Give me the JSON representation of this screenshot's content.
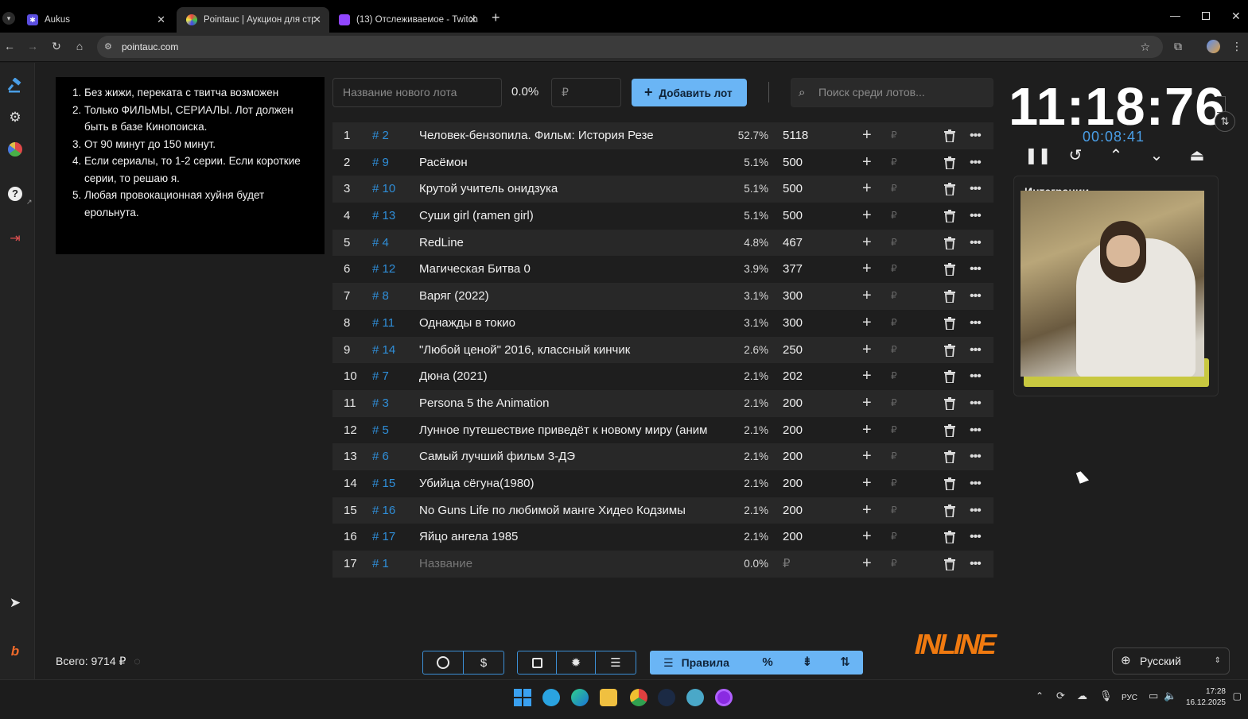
{
  "browser": {
    "tabs": [
      {
        "title": "Aukus",
        "active": false
      },
      {
        "title": "Pointauc | Аукцион для стриме",
        "active": true
      },
      {
        "title": "(13) Отслеживаемое - Twitch",
        "active": false
      }
    ],
    "url": "pointauc.com"
  },
  "rules": [
    "Без жижи, переката с твитча возможен",
    "Только ФИЛЬМЫ,  СЕРИАЛЫ. Лот должен быть в базе Кинопоиска.",
    "От 90 минут до 150 минут.",
    "Если сериалы, то 1-2 серии. Если короткие серии, то решаю я.",
    "Любая провокационная хуйня будет ерольнута."
  ],
  "new_lot": {
    "name_placeholder": "Название нового лота",
    "percent": "0.0%",
    "amount_placeholder": "₽",
    "add_label": "Добавить лот"
  },
  "search": {
    "placeholder": "Поиск среди лотов..."
  },
  "lots": [
    {
      "idx": "1",
      "id": "# 2",
      "name": "Человек-бензопила. Фильм: История Резе",
      "pct": "52.7%",
      "amount": "5118"
    },
    {
      "idx": "2",
      "id": "# 9",
      "name": "Расёмон",
      "pct": "5.1%",
      "amount": "500"
    },
    {
      "idx": "3",
      "id": "# 10",
      "name": "Крутой учитель онидзука",
      "pct": "5.1%",
      "amount": "500"
    },
    {
      "idx": "4",
      "id": "# 13",
      "name": "Суши girl (ramen girl)",
      "pct": "5.1%",
      "amount": "500"
    },
    {
      "idx": "5",
      "id": "# 4",
      "name": "RedLine",
      "pct": "4.8%",
      "amount": "467"
    },
    {
      "idx": "6",
      "id": "# 12",
      "name": "Магическая Битва 0",
      "pct": "3.9%",
      "amount": "377"
    },
    {
      "idx": "7",
      "id": "# 8",
      "name": "Варяг (2022)",
      "pct": "3.1%",
      "amount": "300"
    },
    {
      "idx": "8",
      "id": "# 11",
      "name": "Однажды в токио",
      "pct": "3.1%",
      "amount": "300"
    },
    {
      "idx": "9",
      "id": "# 14",
      "name": "\"Любой ценой\" 2016, классный кинчик",
      "pct": "2.6%",
      "amount": "250"
    },
    {
      "idx": "10",
      "id": "# 7",
      "name": "Дюна (2021)",
      "pct": "2.1%",
      "amount": "202"
    },
    {
      "idx": "11",
      "id": "# 3",
      "name": "Persona 5 the Animation",
      "pct": "2.1%",
      "amount": "200"
    },
    {
      "idx": "12",
      "id": "# 5",
      "name": "Лунное путешествие приведёт к новому миру (аним",
      "pct": "2.1%",
      "amount": "200"
    },
    {
      "idx": "13",
      "id": "# 6",
      "name": "Самый лучший фильм 3-ДЭ",
      "pct": "2.1%",
      "amount": "200"
    },
    {
      "idx": "14",
      "id": "# 15",
      "name": "Убийца сёгуна(1980)",
      "pct": "2.1%",
      "amount": "200"
    },
    {
      "idx": "15",
      "id": "# 16",
      "name": "No Guns Life по любимой манге Хидео Кодзимы",
      "pct": "2.1%",
      "amount": "200"
    },
    {
      "idx": "16",
      "id": "# 17",
      "name": "Яйцо ангела 1985",
      "pct": "2.1%",
      "amount": "200"
    },
    {
      "idx": "17",
      "id": "# 1",
      "name": "Название",
      "pct": "0.0%",
      "amount": "₽",
      "placeholder": true
    }
  ],
  "row_icons": {
    "plus": "+",
    "rub": "₽",
    "more": "•••"
  },
  "timer": {
    "main": "11:18:76",
    "sub": "00:08:41"
  },
  "integrations": {
    "title": "Интеграции"
  },
  "footer": {
    "total": "Всего: 9714 ₽",
    "rules_button": "Правила",
    "percent_button": "%",
    "language": "Русский",
    "logo_text": "INLINE"
  },
  "taskbar": {
    "lang": "РУС",
    "time": "17:28",
    "date": "16.12.2025"
  },
  "colors": {
    "accent": "#6ab5f5",
    "id_blue": "#2f8ed8",
    "background": "#1e1e1e"
  }
}
